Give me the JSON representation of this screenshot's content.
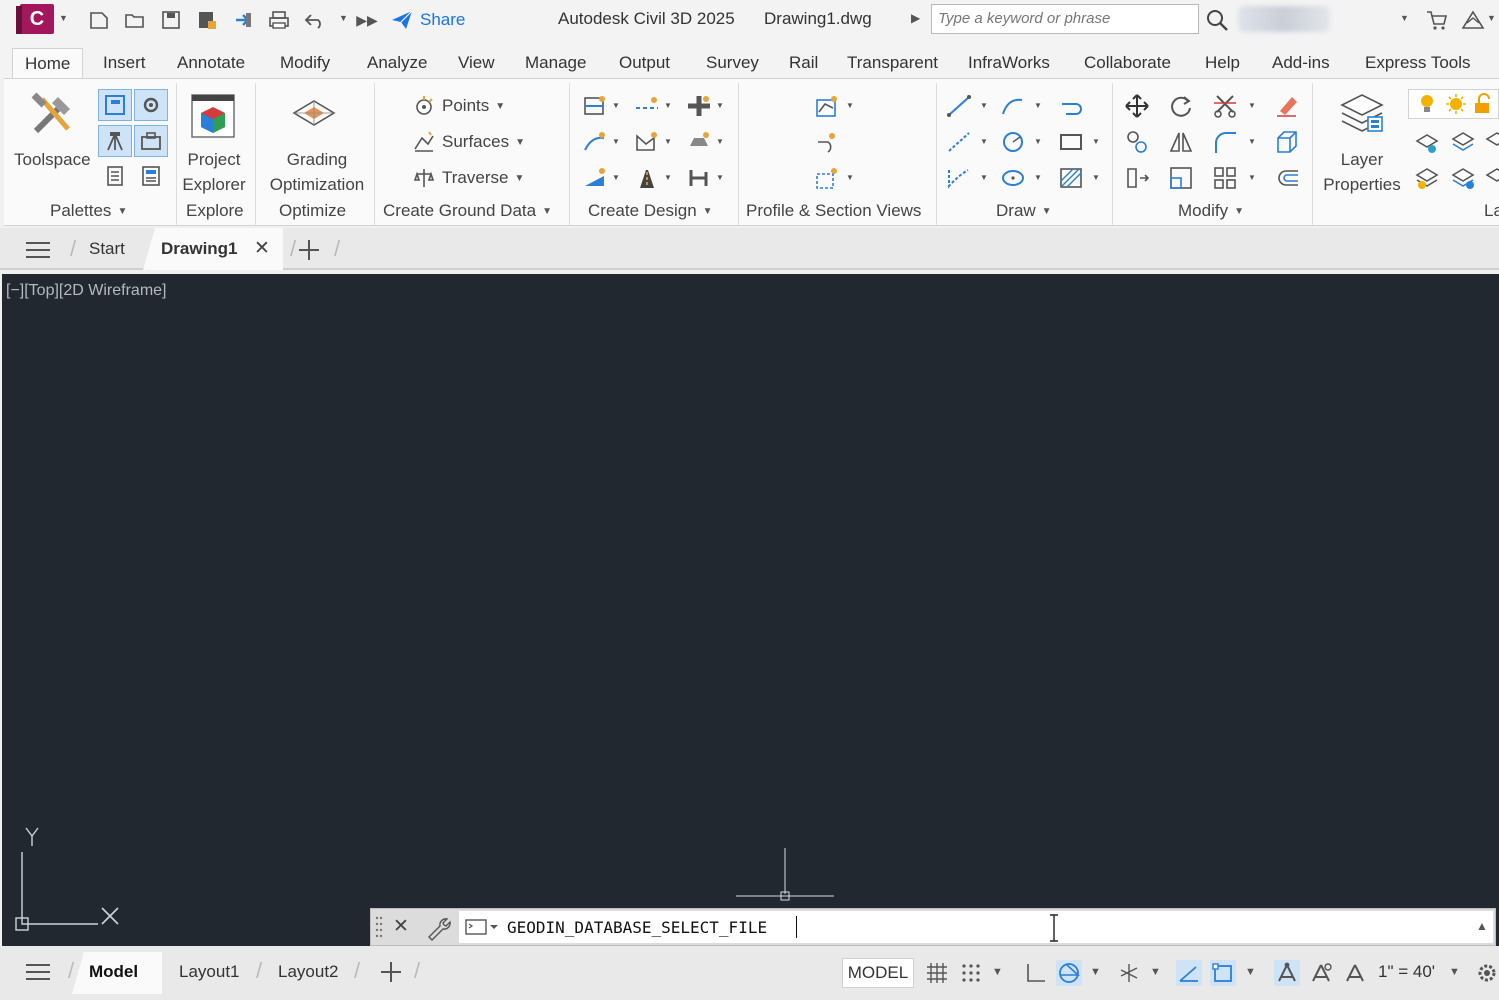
{
  "titlebar": {
    "app_logo_letter": "C",
    "share_label": "Share",
    "app_title": "Autodesk Civil 3D 2025",
    "doc_title": "Drawing1.dwg",
    "search_placeholder": "Type a keyword or phrase"
  },
  "ribbon_tabs": [
    "Home",
    "Insert",
    "Annotate",
    "Modify",
    "Analyze",
    "View",
    "Manage",
    "Output",
    "Survey",
    "Rail",
    "Transparent",
    "InfraWorks",
    "Collaborate",
    "Help",
    "Add-ins",
    "Express Tools"
  ],
  "ribbon": {
    "toolspace_label": "Toolspace",
    "palettes_title": "Palettes",
    "project_label_1": "Project",
    "project_label_2": "Explorer",
    "explore_title": "Explore",
    "grading_label_1": "Grading",
    "grading_label_2": "Optimization",
    "optimize_title": "Optimize",
    "points_label": "Points",
    "surfaces_label": "Surfaces",
    "traverse_label": "Traverse",
    "create_ground_title": "Create Ground Data",
    "create_design_title": "Create Design",
    "profile_title": "Profile & Section Views",
    "draw_title": "Draw",
    "modify_title": "Modify",
    "layer_label_1": "Layer",
    "layer_label_2": "Properties",
    "layers_title_partial": "La"
  },
  "doc_tabs": {
    "start": "Start",
    "drawing": "Drawing1"
  },
  "viewport": {
    "label": "[−][Top][2D Wireframe]",
    "ucs_x": "X",
    "ucs_y": "Y"
  },
  "command": {
    "text": "GEODIN_DATABASE_SELECT_FILE"
  },
  "statusbar": {
    "layout_tabs": [
      "Model",
      "Layout1",
      "Layout2"
    ],
    "model_button": "MODEL",
    "scale": "1\" = 40'"
  }
}
